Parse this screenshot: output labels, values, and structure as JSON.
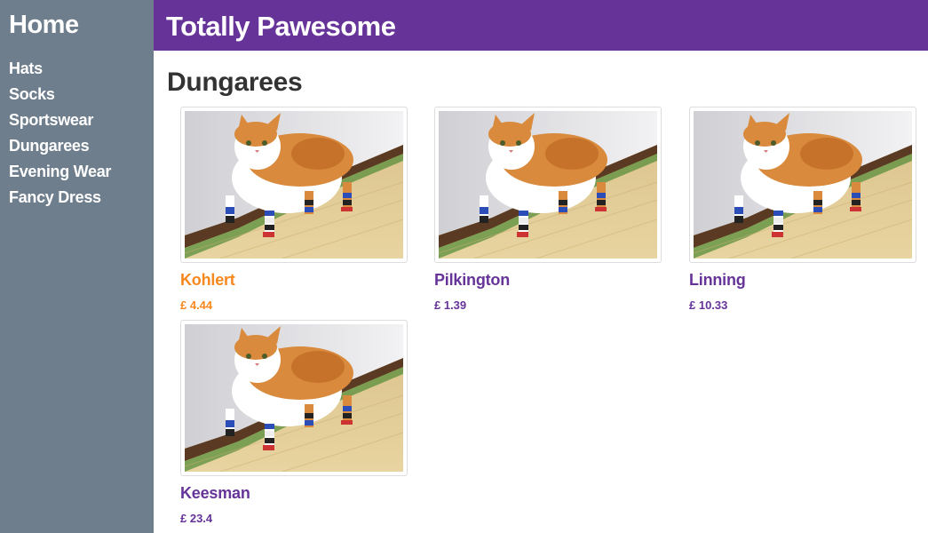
{
  "sidebar": {
    "home_label": "Home",
    "items": [
      {
        "label": "Hats"
      },
      {
        "label": "Socks"
      },
      {
        "label": "Sportswear"
      },
      {
        "label": "Dungarees"
      },
      {
        "label": "Evening Wear"
      },
      {
        "label": "Fancy Dress"
      }
    ]
  },
  "header": {
    "title": "Totally Pawesome"
  },
  "main": {
    "category_title": "Dungarees",
    "products": [
      {
        "name": "Kohlert",
        "price": "£ 4.44",
        "image": "cat-in-socks-photo",
        "highlighted": true
      },
      {
        "name": "Pilkington",
        "price": "£ 1.39",
        "image": "cat-in-socks-photo",
        "highlighted": false
      },
      {
        "name": "Linning",
        "price": "£ 10.33",
        "image": "cat-in-socks-photo",
        "highlighted": false
      },
      {
        "name": "Keesman",
        "price": "£ 23.4",
        "image": "cat-in-socks-photo",
        "highlighted": false
      }
    ]
  },
  "colors": {
    "sidebar_bg": "#6e7e8c",
    "header_bg": "#663399",
    "link": "#663399",
    "link_active": "#f7881e"
  }
}
